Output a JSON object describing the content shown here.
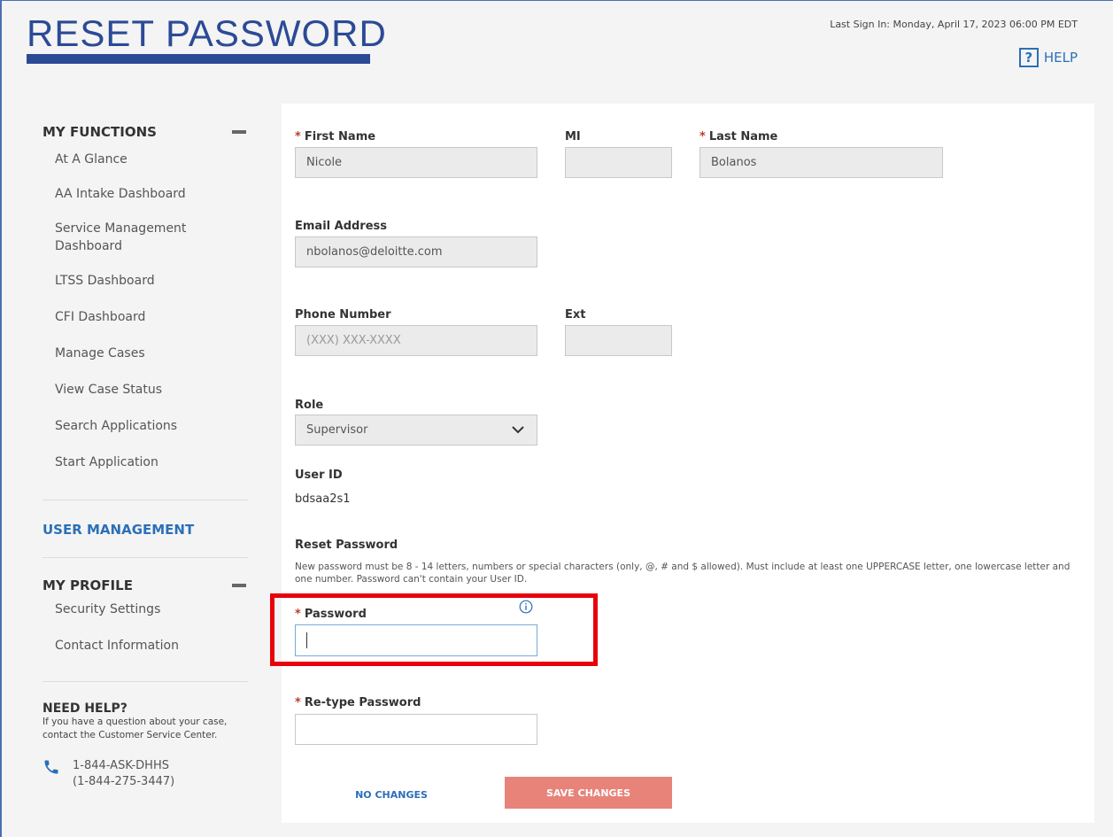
{
  "header": {
    "title": "RESET PASSWORD",
    "last_sign_in": "Last Sign In: Monday, April 17, 2023 06:00 PM EDT",
    "help_icon": "?",
    "help_label": "HELP"
  },
  "sidebar": {
    "my_functions": {
      "heading": "MY FUNCTIONS",
      "items": [
        "At A Glance",
        "AA Intake Dashboard",
        "Service Management Dashboard",
        "LTSS Dashboard",
        "CFI Dashboard",
        "Manage Cases",
        "View Case Status",
        "Search Applications",
        "Start Application"
      ]
    },
    "user_management": "USER MANAGEMENT",
    "my_profile": {
      "heading": "MY PROFILE",
      "items": [
        "Security Settings",
        "Contact Information"
      ]
    },
    "need_help": {
      "title": "NEED HELP?",
      "text": "If you have a question about your case, contact the Customer Service Center.",
      "phone_line1": "1-844-ASK-DHHS",
      "phone_line2": "(1-844-275-3447)"
    }
  },
  "form": {
    "required_marker": "*",
    "first_name": {
      "label": "First Name",
      "value": "Nicole"
    },
    "mi": {
      "label": "MI",
      "value": ""
    },
    "last_name": {
      "label": "Last Name",
      "value": "Bolanos"
    },
    "email": {
      "label": "Email Address",
      "value": "nbolanos@deloitte.com"
    },
    "phone": {
      "label": "Phone Number",
      "placeholder": "(XXX) XXX-XXXX"
    },
    "ext": {
      "label": "Ext",
      "value": ""
    },
    "role": {
      "label": "Role",
      "value": "Supervisor"
    },
    "user_id": {
      "label": "User ID",
      "value": "bdsaa2s1"
    },
    "reset_password": {
      "heading": "Reset Password",
      "hint": "New password must be 8 - 14 letters, numbers or special characters (only, @, # and $ allowed). Must include at least one UPPERCASE letter, one lowercase letter and one number. Password can't contain your User ID."
    },
    "password": {
      "label": "Password",
      "value": ""
    },
    "retype_password": {
      "label": "Re-type Password",
      "value": ""
    }
  },
  "buttons": {
    "no_changes": "NO CHANGES",
    "save_changes": "SAVE CHANGES"
  },
  "colors": {
    "brand_blue": "#2c4a96",
    "link_blue": "#2c6fb8",
    "required_red": "#c0392b",
    "save_button": "#e8837a",
    "highlight_red": "#e8000b"
  }
}
